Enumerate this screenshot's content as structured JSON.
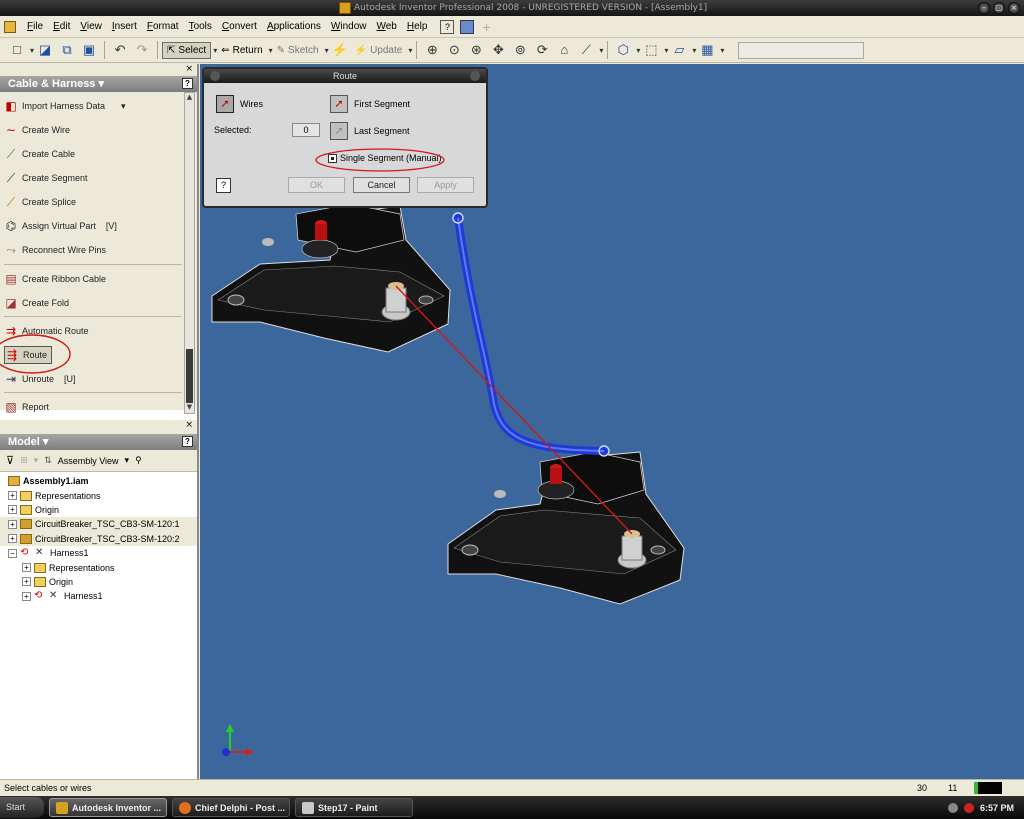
{
  "window": {
    "title": "Autodesk Inventor Professional 2008 - UNREGISTERED VERSION - [Assembly1]"
  },
  "menu": [
    "File",
    "Edit",
    "View",
    "Insert",
    "Format",
    "Tools",
    "Convert",
    "Applications",
    "Window",
    "Web",
    "Help"
  ],
  "toolbar": {
    "select_label": "Select",
    "return_label": "Return",
    "sketch_label": "Sketch",
    "update_label": "Update"
  },
  "cable_panel": {
    "title": "Cable & Harness",
    "commands": [
      {
        "label": "Import Harness Data"
      },
      {
        "label": "Create Wire"
      },
      {
        "label": "Create Cable"
      },
      {
        "label": "Create Segment"
      },
      {
        "label": "Create Splice"
      },
      {
        "label": "Assign Virtual Part",
        "shortcut": "[V]"
      },
      {
        "label": "Reconnect Wire Pins"
      },
      {
        "label": "Create Ribbon Cable"
      },
      {
        "label": "Create Fold"
      },
      {
        "label": "Automatic Route"
      },
      {
        "label": "Route"
      },
      {
        "label": "Unroute",
        "shortcut": "[U]"
      },
      {
        "label": "Report"
      }
    ]
  },
  "model_panel": {
    "title": "Model",
    "view_label": "Assembly View",
    "tree": [
      {
        "label": "Assembly1.iam"
      },
      {
        "label": "Representations"
      },
      {
        "label": "Origin"
      },
      {
        "label": "CircuitBreaker_TSC_CB3-SM-120:1"
      },
      {
        "label": "CircuitBreaker_TSC_CB3-SM-120:2"
      },
      {
        "label": "Harness1"
      },
      {
        "label": "Representations"
      },
      {
        "label": "Origin"
      },
      {
        "label": "Harness1"
      }
    ]
  },
  "route_dialog": {
    "title": "Route",
    "wires_label": "Wires",
    "first_segment_label": "First Segment",
    "selected_label": "Selected:",
    "selected_count": "0",
    "last_segment_label": "Last Segment",
    "single_segment_label": "Single Segment (Manual)",
    "single_segment_checked": true,
    "ok_label": "OK",
    "cancel_label": "Cancel",
    "apply_label": "Apply"
  },
  "status": {
    "message": "Select cables or wires",
    "value1": "30",
    "value2": "11"
  },
  "taskbar": {
    "start_label": "Start",
    "tasks": [
      {
        "label": "Autodesk Inventor ..."
      },
      {
        "label": "Chief Delphi - Post ..."
      },
      {
        "label": "Step17 - Paint"
      }
    ],
    "clock": "6:57 PM"
  },
  "colors": {
    "viewport_bg": "#3c679c",
    "wire": "#d01818",
    "cable": "#1f3ad8",
    "highlight_oval": "#d01818"
  }
}
